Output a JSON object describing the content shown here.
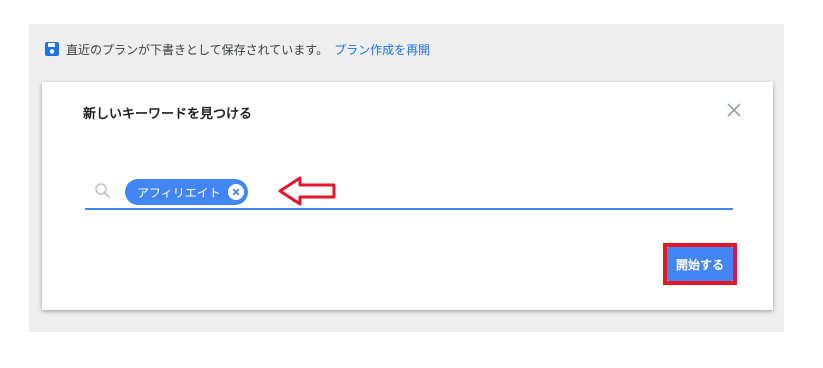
{
  "draft_notice": {
    "text": "直近のプランが下書きとして保存されています。",
    "link_label": "プラン作成を再開",
    "icon": "save-icon"
  },
  "dialog": {
    "title": "新しいキーワードを見つける",
    "close_icon": "close-icon",
    "search": {
      "icon": "search-icon",
      "chips": [
        {
          "label": "アフィリエイト",
          "remove_icon": "close-circle-icon"
        }
      ],
      "value": ""
    },
    "start_button_label": "開始する"
  },
  "annotation": {
    "arrow_icon": "left-arrow-outline-icon",
    "highlight_color": "#e3162c"
  },
  "colors": {
    "accent": "#4285f4",
    "link": "#1a73e8",
    "annotation": "#e3162c"
  }
}
